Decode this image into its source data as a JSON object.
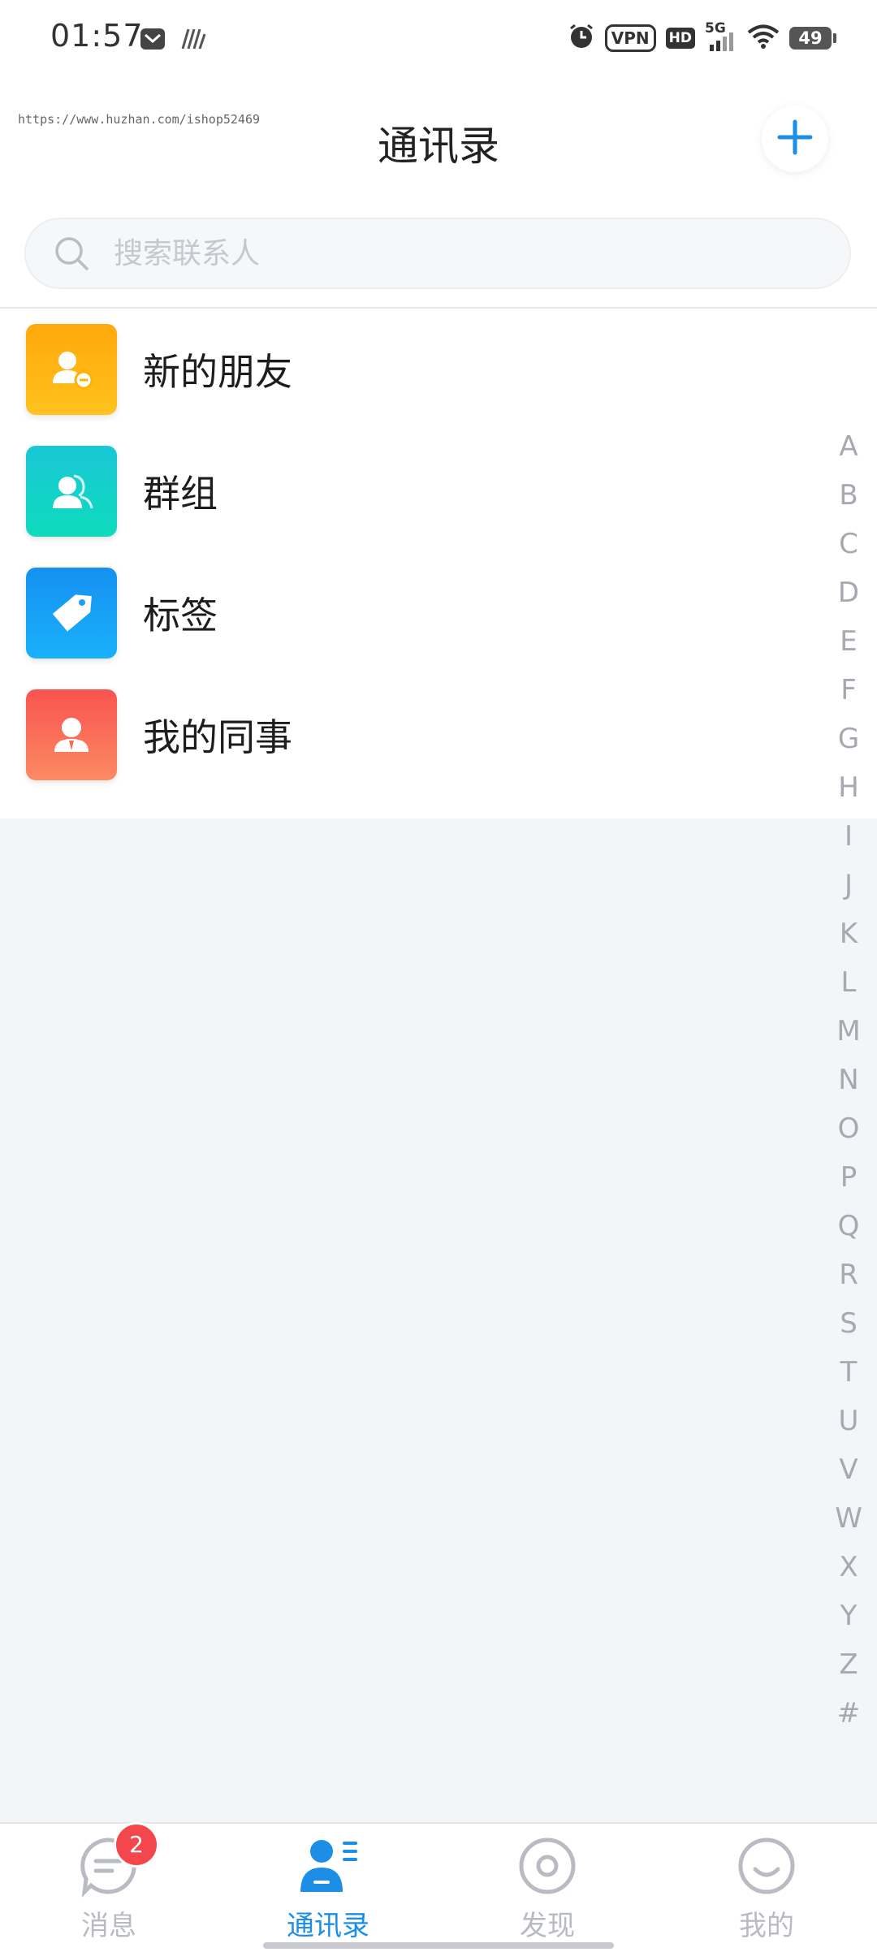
{
  "status_bar": {
    "time": "01:57",
    "vpn": "VPN",
    "hd": "HD",
    "network": "5G",
    "battery": "49"
  },
  "header": {
    "watermark": "https://www.huzhan.com/ishop52469",
    "title": "通讯录",
    "add_icon": "plus-icon"
  },
  "search": {
    "placeholder": "搜索联系人",
    "icon": "search-icon"
  },
  "menu": {
    "items": [
      {
        "label": "新的朋友",
        "icon": "new-friend-icon",
        "color": "#ffb300"
      },
      {
        "label": "群组",
        "icon": "group-icon",
        "color": "#12c9c4"
      },
      {
        "label": "标签",
        "icon": "tag-icon",
        "color": "#1aa3f5"
      },
      {
        "label": "我的同事",
        "icon": "colleague-icon",
        "color": "#fb6a55"
      }
    ]
  },
  "alpha_index": [
    "A",
    "B",
    "C",
    "D",
    "E",
    "F",
    "G",
    "H",
    "I",
    "J",
    "K",
    "L",
    "M",
    "N",
    "O",
    "P",
    "Q",
    "R",
    "S",
    "T",
    "U",
    "V",
    "W",
    "X",
    "Y",
    "Z",
    "#"
  ],
  "tab_bar": {
    "tabs": [
      {
        "label": "消息",
        "icon": "message-icon",
        "badge": "2",
        "active": false
      },
      {
        "label": "通讯录",
        "icon": "contacts-icon",
        "active": true
      },
      {
        "label": "发现",
        "icon": "discover-icon",
        "active": false
      },
      {
        "label": "我的",
        "icon": "profile-icon",
        "active": false
      }
    ]
  },
  "colors": {
    "accent": "#1c8ee6",
    "badge": "#f4474b",
    "inactive": "#b8bbc2"
  }
}
